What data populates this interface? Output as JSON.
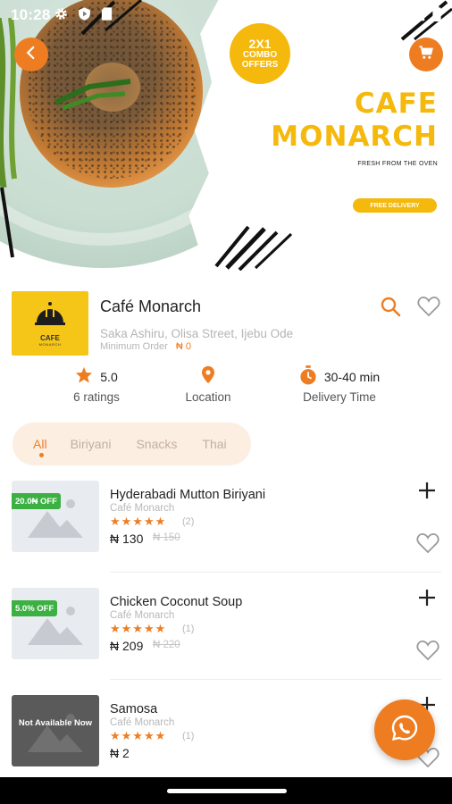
{
  "status_bar": {
    "time": "10:28"
  },
  "hero": {
    "combo_badge": {
      "line1": "2X1",
      "line2": "COMBO",
      "line3": "OFFERS"
    },
    "title_line1": "CAFE",
    "title_line2": "MONARCH",
    "tagline": "FRESH FROM THE OVEN",
    "free_delivery": "FREE DELIVERY"
  },
  "store": {
    "logo_text": "CAFE",
    "logo_subtext": "MONARCH",
    "name": "Café Monarch",
    "address": "Saka Ashiru, Olisa Street, Ijebu Ode",
    "min_order_label": "Minimum Order",
    "min_order_value": "₦ 0"
  },
  "stats": {
    "rating_value": "5.0",
    "rating_count": "6 ratings",
    "location_label": "Location",
    "delivery_value": "30-40 min",
    "delivery_label": "Delivery Time"
  },
  "tabs": [
    {
      "label": "All",
      "active": true
    },
    {
      "label": "Biriyani",
      "active": false
    },
    {
      "label": "Snacks",
      "active": false
    },
    {
      "label": "Thai",
      "active": false
    }
  ],
  "products": [
    {
      "name": "Hyderabadi Mutton Biriyani",
      "store": "Café Monarch",
      "stars": "★★★★★",
      "rating_count": "(2)",
      "price": "₦ 130",
      "old_price": "₦ 150",
      "badge": "20.0₦ OFF",
      "available": true
    },
    {
      "name": "Chicken Coconut Soup",
      "store": "Café Monarch",
      "stars": "★★★★★",
      "rating_count": "(1)",
      "price": "₦ 209",
      "old_price": "₦ 220",
      "badge": "5.0% OFF",
      "available": true
    },
    {
      "name": "Samosa",
      "store": "Café Monarch",
      "stars": "★★★★★",
      "rating_count": "(1)",
      "price": "₦ 2",
      "old_price": "",
      "badge": "",
      "available": false,
      "unavailable_text": "Not Available Now"
    }
  ],
  "colors": {
    "accent": "#ee7d22",
    "brand_yellow": "#f5b80c",
    "discount_green": "#3cb043"
  },
  "icons": {
    "back": "arrow-left-icon",
    "cart": "cart-icon",
    "search": "search-icon",
    "favorite": "heart-icon",
    "star": "star-icon",
    "location": "location-pin-icon",
    "timer": "stopwatch-icon",
    "add": "plus-icon",
    "whatsapp": "whatsapp-icon"
  }
}
